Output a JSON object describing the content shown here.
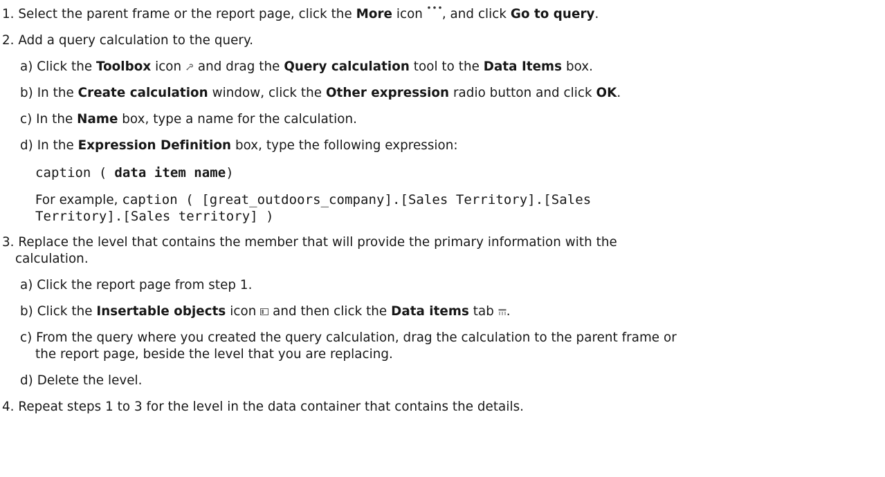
{
  "steps": {
    "s1": {
      "num": "1.",
      "t1": " Select the parent frame or the report page, click the ",
      "b1": "More",
      "t2": " icon ",
      "t3": ", and click ",
      "b2": "Go to query",
      "t4": "."
    },
    "s2": {
      "num": "2.",
      "text": " Add a query calculation to the query.",
      "a": {
        "label": "a)",
        "t1": " Click the ",
        "b1": "Toolbox",
        "t2": " icon ",
        "t3": " and drag the ",
        "b2": "Query calculation",
        "t4": " tool to the ",
        "b3": "Data Items",
        "t5": " box."
      },
      "b": {
        "label": "b)",
        "t1": " In the ",
        "b1": "Create calculation",
        "t2": " window, click the ",
        "b2": "Other expression",
        "t3": " radio button and click ",
        "b3": "OK",
        "t4": "."
      },
      "c": {
        "label": "c)",
        "t1": " In the ",
        "b1": "Name",
        "t2": " box, type a name for the calculation."
      },
      "d": {
        "label": "d)",
        "t1": " In the ",
        "b1": "Expression Definition",
        "t2": " box, type the following expression:",
        "code_prefix": "caption (",
        "code_bold": "data item name",
        "code_suffix": ")",
        "example_prefix": "For example, ",
        "example_code_line1": "caption ( [great_outdoors_company].[Sales Territory].[Sales",
        "example_code_line2": "Territory].[Sales territory] )"
      }
    },
    "s3": {
      "num": "3.",
      "text_line1": " Replace the level that contains the member that will provide the primary information with the",
      "text_line2": "calculation.",
      "a": {
        "label": "a)",
        "text": " Click the report page from step 1."
      },
      "b": {
        "label": "b)",
        "t1": " Click the ",
        "b1": "Insertable objects",
        "t2": " icon ",
        "t3": " and then click the ",
        "b2": "Data items",
        "t4": " tab ",
        "t5": "."
      },
      "c": {
        "label": "c)",
        "line1": " From the query where you created the query calculation, drag the calculation to the parent frame or",
        "line2": "the report page, beside the level that you are replacing."
      },
      "d": {
        "label": "d)",
        "text": " Delete the level."
      }
    },
    "s4": {
      "num": "4.",
      "text": " Repeat steps 1 to 3 for the level in the data container that contains the details."
    }
  },
  "icons": {
    "more": "more-icon",
    "toolbox": "toolbox-icon",
    "insertable_objects": "insertable-objects-icon",
    "data_items_tab": "data-items-tab-icon"
  }
}
